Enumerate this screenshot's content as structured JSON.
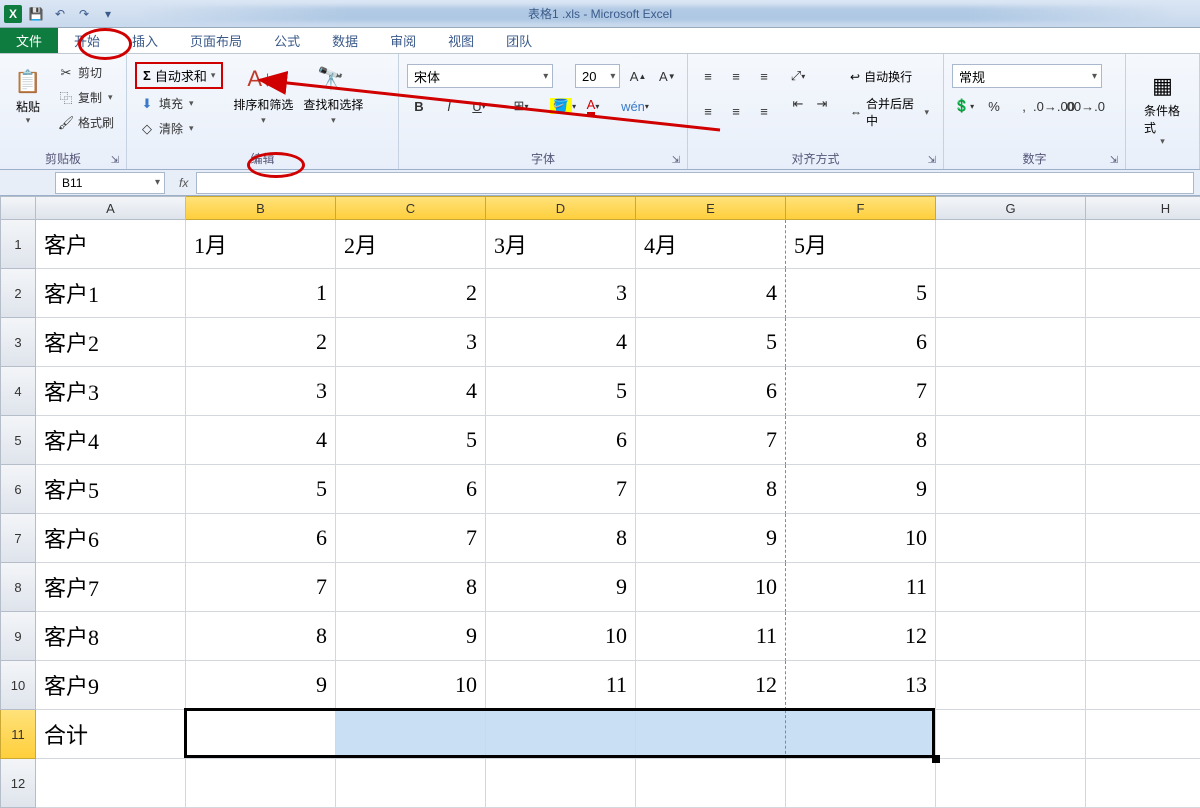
{
  "title": "表格1 .xls  -  Microsoft Excel",
  "tabs": {
    "file": "文件",
    "home": "开始",
    "insert": "插入",
    "layout": "页面布局",
    "formulas": "公式",
    "data": "数据",
    "review": "审阅",
    "view": "视图",
    "team": "团队"
  },
  "ribbon": {
    "clipboard": {
      "label": "剪贴板",
      "paste": "粘贴",
      "cut": "剪切",
      "copy": "复制",
      "format_painter": "格式刷"
    },
    "edit": {
      "label": "编辑",
      "autosum": "自动求和",
      "fill": "填充",
      "clear": "清除",
      "sort_filter": "排序和筛选",
      "find_select": "查找和选择"
    },
    "font": {
      "label": "字体",
      "name": "宋体",
      "size": "20"
    },
    "align": {
      "label": "对齐方式",
      "wrap": "自动换行",
      "merge": "合并后居中"
    },
    "number": {
      "label": "数字",
      "format": "常规"
    },
    "styles": {
      "label": "",
      "cond_format": "条件格式"
    }
  },
  "formula_bar": {
    "namebox": "B11",
    "formula": ""
  },
  "columns": [
    "A",
    "B",
    "C",
    "D",
    "E",
    "F",
    "G",
    "H"
  ],
  "col_widths": {
    "A": 150,
    "B": 150,
    "C": 150,
    "D": 150,
    "E": 150,
    "F": 150,
    "G": 150,
    "H": 160
  },
  "selected_cols": [
    "B",
    "C",
    "D",
    "E",
    "F"
  ],
  "selected_row": 11,
  "rows": [
    {
      "n": 1,
      "cells": [
        "客户",
        "1月",
        "2月",
        "3月",
        "4月",
        "5月",
        "",
        ""
      ]
    },
    {
      "n": 2,
      "cells": [
        "客户1",
        "1",
        "2",
        "3",
        "4",
        "5",
        "",
        ""
      ]
    },
    {
      "n": 3,
      "cells": [
        "客户2",
        "2",
        "3",
        "4",
        "5",
        "6",
        "",
        ""
      ]
    },
    {
      "n": 4,
      "cells": [
        "客户3",
        "3",
        "4",
        "5",
        "6",
        "7",
        "",
        ""
      ]
    },
    {
      "n": 5,
      "cells": [
        "客户4",
        "4",
        "5",
        "6",
        "7",
        "8",
        "",
        ""
      ]
    },
    {
      "n": 6,
      "cells": [
        "客户5",
        "5",
        "6",
        "7",
        "8",
        "9",
        "",
        ""
      ]
    },
    {
      "n": 7,
      "cells": [
        "客户6",
        "6",
        "7",
        "8",
        "9",
        "10",
        "",
        ""
      ]
    },
    {
      "n": 8,
      "cells": [
        "客户7",
        "7",
        "8",
        "9",
        "10",
        "11",
        "",
        ""
      ]
    },
    {
      "n": 9,
      "cells": [
        "客户8",
        "8",
        "9",
        "10",
        "11",
        "12",
        "",
        ""
      ]
    },
    {
      "n": 10,
      "cells": [
        "客户9",
        "9",
        "10",
        "11",
        "12",
        "13",
        "",
        ""
      ]
    },
    {
      "n": 11,
      "cells": [
        "合计",
        "",
        "",
        "",
        "",
        "",
        "",
        ""
      ]
    },
    {
      "n": 12,
      "cells": [
        "",
        "",
        "",
        "",
        "",
        "",
        "",
        ""
      ]
    }
  ]
}
